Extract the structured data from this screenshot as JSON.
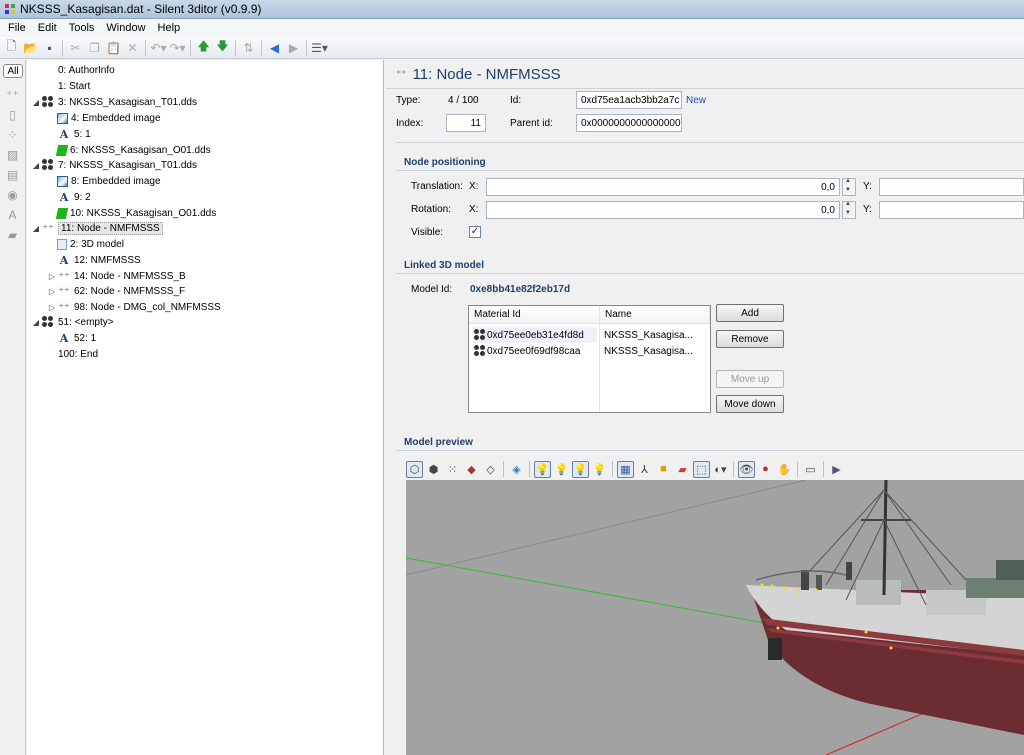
{
  "window": {
    "title": "NKSSS_Kasagisan.dat - Silent 3ditor (v0.9.9)"
  },
  "menu": [
    "File",
    "Edit",
    "Tools",
    "Window",
    "Help"
  ],
  "sidebar": {
    "all_label": "All"
  },
  "tree": [
    {
      "label": "0: AuthorInfo",
      "icon": "none",
      "indent": 0,
      "expander": ""
    },
    {
      "label": "1: Start",
      "icon": "none",
      "indent": 0,
      "expander": ""
    },
    {
      "label": "3: NKSSS_Kasagisan_T01.dds",
      "icon": "material-icon",
      "indent": 0,
      "expander": "◢"
    },
    {
      "label": "4: Embedded image",
      "icon": "image-icon",
      "indent": 1,
      "expander": ""
    },
    {
      "label": "5: 1",
      "icon": "text-icon",
      "indent": 1,
      "expander": ""
    },
    {
      "label": "6: NKSSS_Kasagisan_O01.dds",
      "icon": "texture-icon",
      "indent": 1,
      "expander": ""
    },
    {
      "label": "7: NKSSS_Kasagisan_T01.dds",
      "icon": "material-icon",
      "indent": 0,
      "expander": "◢"
    },
    {
      "label": "8: Embedded image",
      "icon": "image-icon",
      "indent": 1,
      "expander": ""
    },
    {
      "label": "9: 2",
      "icon": "text-icon",
      "indent": 1,
      "expander": ""
    },
    {
      "label": "10: NKSSS_Kasagisan_O01.dds",
      "icon": "texture-icon",
      "indent": 1,
      "expander": ""
    },
    {
      "label": "11: Node - NMFMSSS",
      "icon": "node-icon",
      "indent": 0,
      "expander": "◢",
      "selected": true
    },
    {
      "label": "2: 3D model",
      "icon": "model-icon",
      "indent": 1,
      "expander": ""
    },
    {
      "label": "12: NMFMSSS",
      "icon": "text-icon",
      "indent": 1,
      "expander": ""
    },
    {
      "label": "14: Node - NMFMSSS_B",
      "icon": "node-icon",
      "indent": 1,
      "expander": "▷"
    },
    {
      "label": "62: Node - NMFMSSS_F",
      "icon": "node-icon",
      "indent": 1,
      "expander": "▷"
    },
    {
      "label": "98: Node - DMG_col_NMFMSSS",
      "icon": "node-icon",
      "indent": 1,
      "expander": "▷"
    },
    {
      "label": "51: <empty>",
      "icon": "material-icon",
      "indent": 0,
      "expander": "◢"
    },
    {
      "label": "52: 1",
      "icon": "text-icon",
      "indent": 1,
      "expander": ""
    },
    {
      "label": "100: End",
      "icon": "none",
      "indent": 0,
      "expander": ""
    }
  ],
  "header": {
    "title": "11: Node - NMFMSSS",
    "type_label": "Type:",
    "type_value": "4 / 100",
    "id_label": "Id:",
    "id_value": "0xd75ea1acb3bb2a7c",
    "id_new": "New",
    "index_label": "Index:",
    "index_value": "11",
    "parent_label": "Parent id:",
    "parent_value": "0x0000000000000000"
  },
  "positioning": {
    "section": "Node positioning",
    "translation_label": "Translation:",
    "rotation_label": "Rotation:",
    "visible_label": "Visible:",
    "x_label": "X:",
    "y_label": "Y:",
    "translation_x": "0,0",
    "rotation_x": "0,0",
    "visible_mark": "✓"
  },
  "linked": {
    "section": "Linked 3D model",
    "model_id_label": "Model Id:",
    "model_id_value": "0xe8bb41e82f2eb17d",
    "columns": [
      "Material Id",
      "Name"
    ],
    "rows": [
      {
        "id": "0xd75ee0eb31e4fd8d",
        "name": "NKSSS_Kasagisa..."
      },
      {
        "id": "0xd75ee0f69df98caa",
        "name": "NKSSS_Kasagisa..."
      }
    ],
    "add": "Add",
    "remove": "Remove",
    "move_up": "Move up",
    "move_down": "Move down"
  },
  "preview": {
    "section": "Model preview",
    "bg_color": "#a2a2a2"
  }
}
